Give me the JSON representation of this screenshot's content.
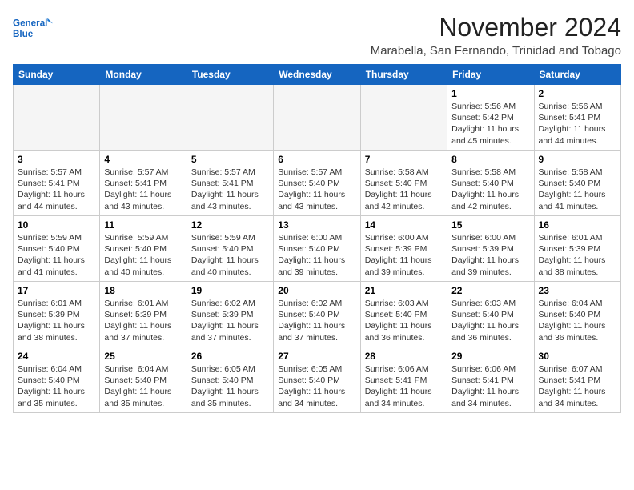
{
  "header": {
    "logo_line1": "General",
    "logo_line2": "Blue",
    "month": "November 2024",
    "location": "Marabella, San Fernando, Trinidad and Tobago"
  },
  "weekdays": [
    "Sunday",
    "Monday",
    "Tuesday",
    "Wednesday",
    "Thursday",
    "Friday",
    "Saturday"
  ],
  "weeks": [
    [
      {
        "day": "",
        "info": ""
      },
      {
        "day": "",
        "info": ""
      },
      {
        "day": "",
        "info": ""
      },
      {
        "day": "",
        "info": ""
      },
      {
        "day": "",
        "info": ""
      },
      {
        "day": "1",
        "info": "Sunrise: 5:56 AM\nSunset: 5:42 PM\nDaylight: 11 hours and 45 minutes."
      },
      {
        "day": "2",
        "info": "Sunrise: 5:56 AM\nSunset: 5:41 PM\nDaylight: 11 hours and 44 minutes."
      }
    ],
    [
      {
        "day": "3",
        "info": "Sunrise: 5:57 AM\nSunset: 5:41 PM\nDaylight: 11 hours and 44 minutes."
      },
      {
        "day": "4",
        "info": "Sunrise: 5:57 AM\nSunset: 5:41 PM\nDaylight: 11 hours and 43 minutes."
      },
      {
        "day": "5",
        "info": "Sunrise: 5:57 AM\nSunset: 5:41 PM\nDaylight: 11 hours and 43 minutes."
      },
      {
        "day": "6",
        "info": "Sunrise: 5:57 AM\nSunset: 5:40 PM\nDaylight: 11 hours and 43 minutes."
      },
      {
        "day": "7",
        "info": "Sunrise: 5:58 AM\nSunset: 5:40 PM\nDaylight: 11 hours and 42 minutes."
      },
      {
        "day": "8",
        "info": "Sunrise: 5:58 AM\nSunset: 5:40 PM\nDaylight: 11 hours and 42 minutes."
      },
      {
        "day": "9",
        "info": "Sunrise: 5:58 AM\nSunset: 5:40 PM\nDaylight: 11 hours and 41 minutes."
      }
    ],
    [
      {
        "day": "10",
        "info": "Sunrise: 5:59 AM\nSunset: 5:40 PM\nDaylight: 11 hours and 41 minutes."
      },
      {
        "day": "11",
        "info": "Sunrise: 5:59 AM\nSunset: 5:40 PM\nDaylight: 11 hours and 40 minutes."
      },
      {
        "day": "12",
        "info": "Sunrise: 5:59 AM\nSunset: 5:40 PM\nDaylight: 11 hours and 40 minutes."
      },
      {
        "day": "13",
        "info": "Sunrise: 6:00 AM\nSunset: 5:40 PM\nDaylight: 11 hours and 39 minutes."
      },
      {
        "day": "14",
        "info": "Sunrise: 6:00 AM\nSunset: 5:39 PM\nDaylight: 11 hours and 39 minutes."
      },
      {
        "day": "15",
        "info": "Sunrise: 6:00 AM\nSunset: 5:39 PM\nDaylight: 11 hours and 39 minutes."
      },
      {
        "day": "16",
        "info": "Sunrise: 6:01 AM\nSunset: 5:39 PM\nDaylight: 11 hours and 38 minutes."
      }
    ],
    [
      {
        "day": "17",
        "info": "Sunrise: 6:01 AM\nSunset: 5:39 PM\nDaylight: 11 hours and 38 minutes."
      },
      {
        "day": "18",
        "info": "Sunrise: 6:01 AM\nSunset: 5:39 PM\nDaylight: 11 hours and 37 minutes."
      },
      {
        "day": "19",
        "info": "Sunrise: 6:02 AM\nSunset: 5:39 PM\nDaylight: 11 hours and 37 minutes."
      },
      {
        "day": "20",
        "info": "Sunrise: 6:02 AM\nSunset: 5:40 PM\nDaylight: 11 hours and 37 minutes."
      },
      {
        "day": "21",
        "info": "Sunrise: 6:03 AM\nSunset: 5:40 PM\nDaylight: 11 hours and 36 minutes."
      },
      {
        "day": "22",
        "info": "Sunrise: 6:03 AM\nSunset: 5:40 PM\nDaylight: 11 hours and 36 minutes."
      },
      {
        "day": "23",
        "info": "Sunrise: 6:04 AM\nSunset: 5:40 PM\nDaylight: 11 hours and 36 minutes."
      }
    ],
    [
      {
        "day": "24",
        "info": "Sunrise: 6:04 AM\nSunset: 5:40 PM\nDaylight: 11 hours and 35 minutes."
      },
      {
        "day": "25",
        "info": "Sunrise: 6:04 AM\nSunset: 5:40 PM\nDaylight: 11 hours and 35 minutes."
      },
      {
        "day": "26",
        "info": "Sunrise: 6:05 AM\nSunset: 5:40 PM\nDaylight: 11 hours and 35 minutes."
      },
      {
        "day": "27",
        "info": "Sunrise: 6:05 AM\nSunset: 5:40 PM\nDaylight: 11 hours and 34 minutes."
      },
      {
        "day": "28",
        "info": "Sunrise: 6:06 AM\nSunset: 5:41 PM\nDaylight: 11 hours and 34 minutes."
      },
      {
        "day": "29",
        "info": "Sunrise: 6:06 AM\nSunset: 5:41 PM\nDaylight: 11 hours and 34 minutes."
      },
      {
        "day": "30",
        "info": "Sunrise: 6:07 AM\nSunset: 5:41 PM\nDaylight: 11 hours and 34 minutes."
      }
    ]
  ]
}
